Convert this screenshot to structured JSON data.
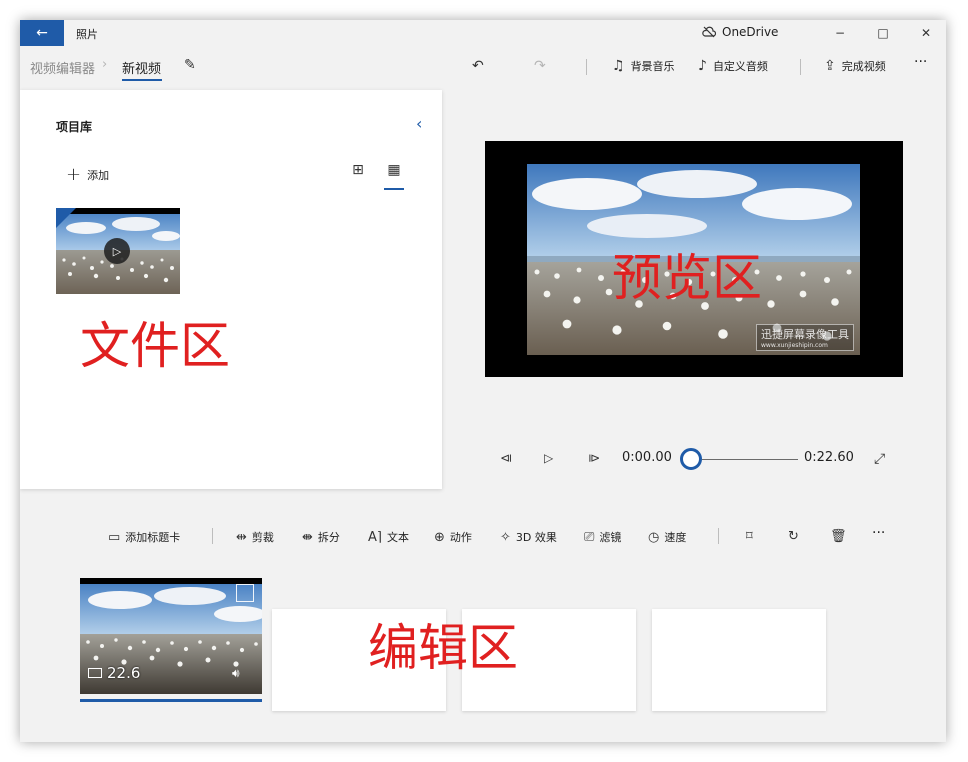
{
  "titlebar": {
    "app_title": "照片",
    "onedrive": "OneDrive",
    "minimize": "−",
    "maximize": "□",
    "close": "✕"
  },
  "toolbar": {
    "breadcrumb_root": "视频编辑器",
    "breadcrumb_current": "新视频",
    "bg_music": "背景音乐",
    "custom_audio": "自定义音频",
    "finish_video": "完成视频",
    "more": "···"
  },
  "library": {
    "title": "项目库",
    "add": "添加"
  },
  "annotations": {
    "files_zone": "文件区",
    "preview_zone": "预览区",
    "edit_zone": "编辑区"
  },
  "preview": {
    "watermark": "迅捷屏幕录像工具",
    "watermark_url": "www.xunjieshipin.com"
  },
  "playback": {
    "current_time": "0:00.00",
    "total_time": "0:22.60",
    "position": 0.0
  },
  "edit_toolbar": {
    "add_title_card": "添加标题卡",
    "trim": "剪裁",
    "split": "拆分",
    "text": "文本",
    "motion": "动作",
    "effects_3d": "3D 效果",
    "filters": "滤镜",
    "speed": "速度",
    "more": "···"
  },
  "storyboard": {
    "clip_duration": "22.6"
  }
}
